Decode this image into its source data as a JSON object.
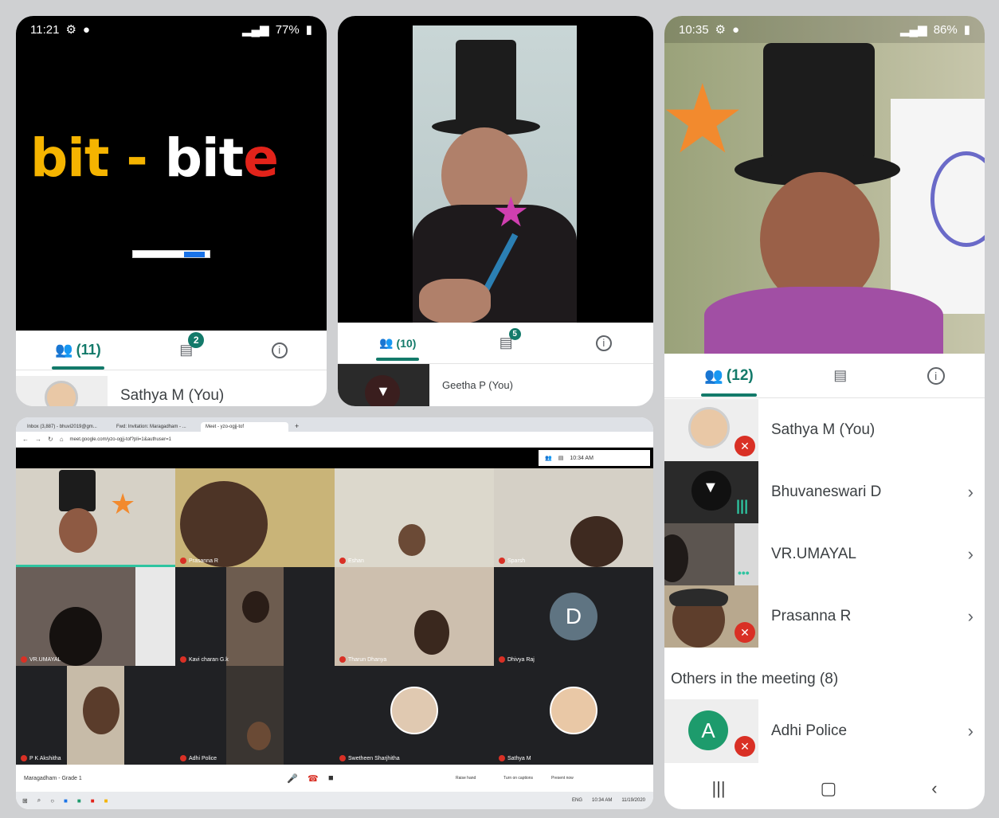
{
  "panel1": {
    "status": {
      "time": "11:21",
      "battery": "77%"
    },
    "slide": {
      "word_a": "bit",
      "dash": " - ",
      "word_b": "bi",
      "word_c": "t",
      "word_d": "e"
    },
    "tabs": {
      "people": "(11)",
      "chat_badge": "2"
    },
    "participant": "Sathya M (You)"
  },
  "panel2": {
    "tabs": {
      "people": "(10)",
      "chat_badge": "5"
    },
    "participant": "Geetha P (You)"
  },
  "panel3": {
    "status": {
      "time": "10:35",
      "battery": "86%"
    },
    "tabs": {
      "people": "(12)"
    },
    "participants": [
      {
        "name": "Sathya M (You)"
      },
      {
        "name": "Bhuvaneswari D"
      },
      {
        "name": "VR.UMAYAL"
      },
      {
        "name": "Prasanna R"
      }
    ],
    "others_heading": "Others in the meeting (8)",
    "others": [
      {
        "initial": "A",
        "name": "Adhi Police"
      }
    ]
  },
  "browser": {
    "tabs": [
      "Inbox (3,887) - bhuvi2019@gm...",
      "Fwd: Invitation: Maragadham - ...",
      "Meet - yzo-ogjj-tof"
    ],
    "url": "meet.google.com/yzo-ogjj-tof?pli=1&authuser=1",
    "meet_time": "10:34 AM",
    "tile_names": [
      "",
      "Prasanna R",
      "Eshan",
      "Sparsh",
      "VR.UMAYAL",
      "Kavi charan G.k",
      "Tharun Dhanya",
      "Dhivya Raj",
      "P K Akshitha",
      "Adhi Police",
      "Swetheen Sharjhitha",
      "Sathya M"
    ],
    "d_initial": "D",
    "meeting_label": "Maragadham - Grade 1",
    "controls": [
      "Raise hand",
      "Turn on captions",
      "Present now"
    ],
    "tray": {
      "lang": "ENG",
      "time": "10:34 AM",
      "date": "11/19/2020"
    }
  },
  "colors": {
    "accent": "#137a6a",
    "mic_off": "#d93025",
    "slide_yellow": "#f5b400",
    "slide_red": "#e2231a"
  }
}
